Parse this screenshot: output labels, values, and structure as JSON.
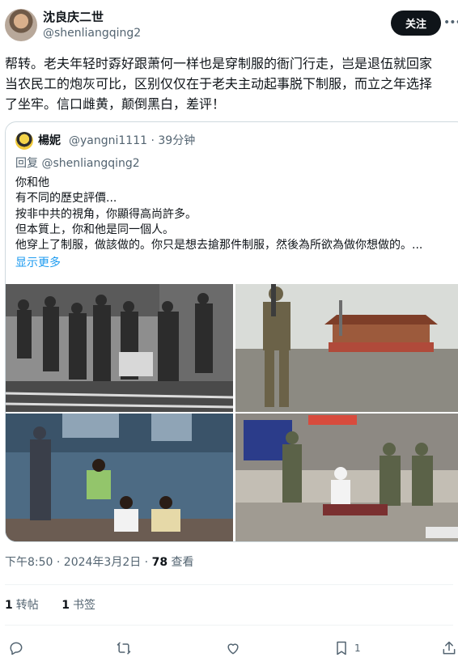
{
  "author": {
    "name": "沈良庆二世",
    "handle": "@shenliangqing2",
    "follow_label": "关注",
    "more_label": "•••"
  },
  "tweet_lines": [
    "帮转。老夫年轻时孬好跟萧何一样也是穿制服的衙门行走，岂是退伍就回家",
    "当农民工的炮灰可比，区别仅仅在于老夫主动起事脱下制服，而立之年选择",
    "了坐牢。信口雌黄，颠倒黑白，差评！"
  ],
  "quote": {
    "name": "楊妮",
    "handle": "@yangni1111",
    "time": "39分钟",
    "reply_to": "回复 @shenliangqing2",
    "lines": [
      "你和他",
      "有不同的歷史評價...",
      "按非中共的視角，你顯得高尚許多。",
      "但本質上，你和他是同一個人。",
      "他穿上了制服，做該做的。你只是想去搶那件制服，然後為所欲為做你想做的。..."
    ],
    "show_more": "显示更多",
    "images": [
      "photo-1",
      "photo-2",
      "photo-3",
      "photo-4"
    ]
  },
  "meta": {
    "timestamp": "下午8:50 · 2024年3月2日 · ",
    "views": "78",
    "views_label": " 查看"
  },
  "stats": {
    "reposts": "1",
    "reposts_label": "转帖",
    "bookmarks": "1",
    "bookmarks_label": "书签"
  },
  "actions": {
    "bookmark_count": "1",
    "icons": [
      "reply-icon",
      "retweet-icon",
      "like-icon",
      "bookmark-icon",
      "share-icon"
    ]
  },
  "colors": {
    "accent": "#1d9bf0",
    "text": "#0f1419",
    "muted": "#536471",
    "border": "#cfd9de"
  }
}
